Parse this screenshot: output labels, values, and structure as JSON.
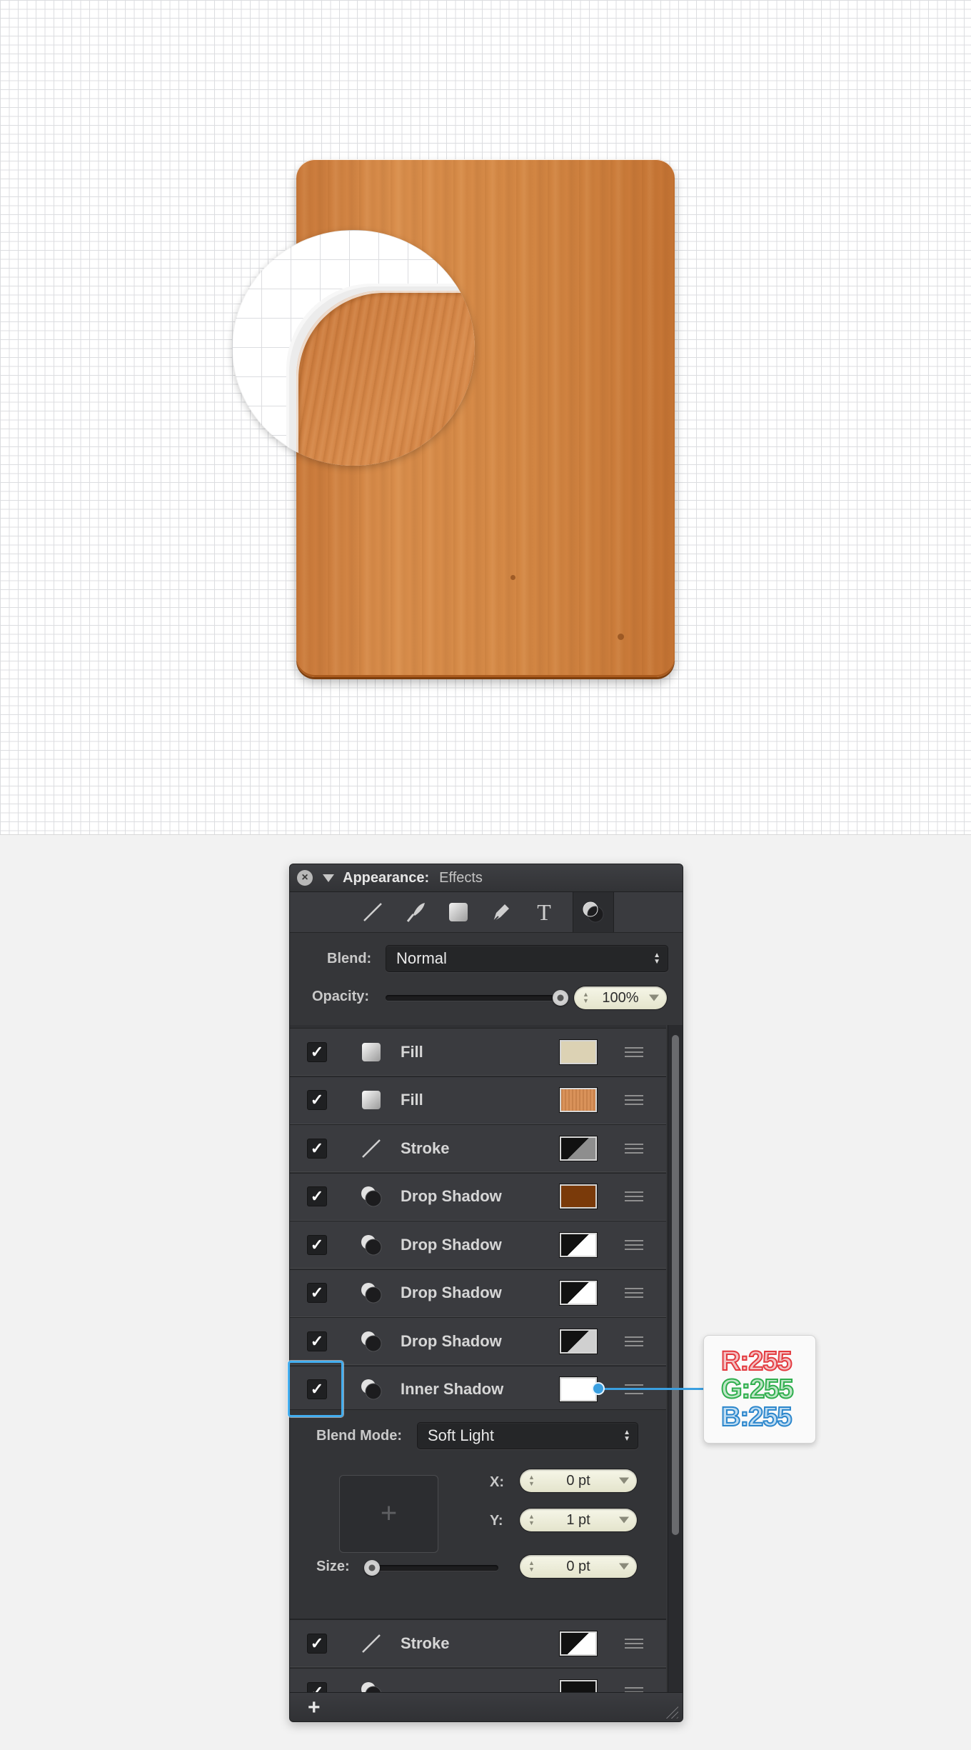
{
  "panel": {
    "title": "Appearance:",
    "subtitle": "Effects",
    "tools": [
      "stroke-tool-icon",
      "brush-tool-icon",
      "fill-tool-icon",
      "pen-tool-icon",
      "text-tool-icon",
      "effects-tool-icon"
    ],
    "blend_label": "Blend:",
    "blend_value": "Normal",
    "opacity_label": "Opacity:",
    "opacity_value": "100%",
    "opacity_fraction": 1.0
  },
  "effects": [
    {
      "label": "Fill",
      "checked": "✓",
      "icon": "fill-icon",
      "swatch_color": "#dcd2b4",
      "swatch_kind": "solid"
    },
    {
      "label": "Fill",
      "checked": "✓",
      "icon": "fill-icon",
      "swatch_color": "#d9925a",
      "swatch_kind": "wood"
    },
    {
      "label": "Stroke",
      "checked": "✓",
      "icon": "stroke-icon",
      "swatch_color": "#8e8e8e",
      "swatch_kind": "split-gray"
    },
    {
      "label": "Drop Shadow",
      "checked": "✓",
      "icon": "shadow-icon",
      "swatch_color": "#7a3a0a",
      "swatch_kind": "solid"
    },
    {
      "label": "Drop Shadow",
      "checked": "✓",
      "icon": "shadow-icon",
      "swatch_color": "#ffffff",
      "swatch_kind": "split-white"
    },
    {
      "label": "Drop Shadow",
      "checked": "✓",
      "icon": "shadow-icon",
      "swatch_color": "#ffffff",
      "swatch_kind": "split-white"
    },
    {
      "label": "Drop Shadow",
      "checked": "✓",
      "icon": "shadow-icon",
      "swatch_color": "#d0d0d0",
      "swatch_kind": "split-light"
    },
    {
      "label": "Inner Shadow",
      "checked": "✓",
      "icon": "shadow-icon",
      "swatch_color": "#ffffff",
      "swatch_kind": "solid"
    }
  ],
  "inner_shadow_detail": {
    "blend_mode_label": "Blend Mode:",
    "blend_mode_value": "Soft Light",
    "x_label": "X:",
    "x_value": "0 pt",
    "y_label": "Y:",
    "y_value": "1 pt",
    "size_label": "Size:",
    "size_value": "0 pt",
    "size_fraction": 0.0
  },
  "after_detail": [
    {
      "label": "Stroke",
      "checked": "✓",
      "icon": "stroke-icon",
      "swatch_kind": "split-white"
    }
  ],
  "bottom_bar": {
    "add_label": "+"
  },
  "rgb_callout": {
    "r": "R:255",
    "g": "G:255",
    "b": "B:255"
  },
  "colors": {
    "panel_bg": "#353639",
    "highlight": "#43aef0",
    "wood": "#d58946"
  }
}
